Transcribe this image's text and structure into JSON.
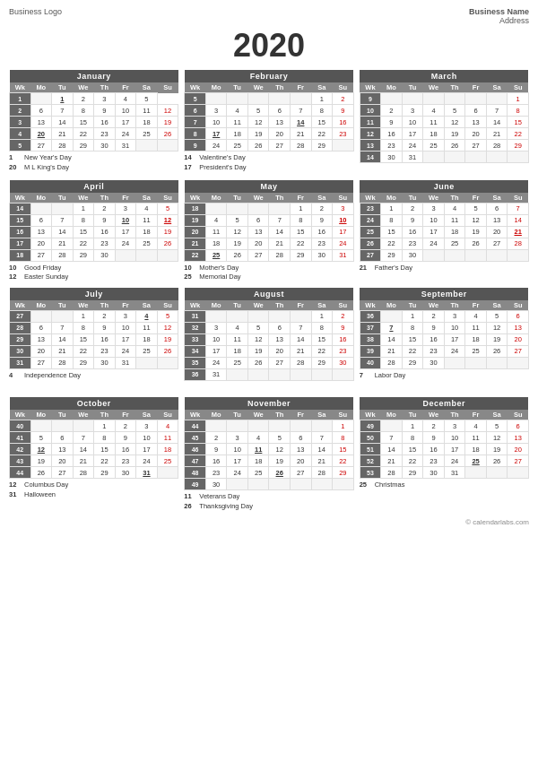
{
  "business_logo": "Business Logo",
  "business_name": "Business Name",
  "business_address": "Address",
  "year": "2020",
  "footer": "© calendarlabs.com",
  "months": [
    {
      "name": "January",
      "weeks": [
        [
          "1",
          "",
          "1",
          "2",
          "3",
          "4",
          "5"
        ],
        [
          "2",
          "6",
          "7",
          "8",
          "9",
          "10",
          "11",
          "12"
        ],
        [
          "3",
          "13",
          "14",
          "15",
          "16",
          "17",
          "18",
          "19"
        ],
        [
          "4",
          "20",
          "21",
          "22",
          "23",
          "24",
          "25",
          "26"
        ],
        [
          "5",
          "27",
          "28",
          "29",
          "30",
          "31",
          "",
          ""
        ]
      ],
      "holidays": [
        {
          "num": "1",
          "text": "New Year's Day"
        },
        {
          "num": "20",
          "text": "M L King's Day"
        }
      ],
      "bold_days": [
        "1",
        "20"
      ]
    },
    {
      "name": "February",
      "weeks": [
        [
          "5",
          "",
          "",
          "",
          "",
          "",
          "1",
          "2"
        ],
        [
          "6",
          "3",
          "4",
          "5",
          "6",
          "7",
          "8",
          "9"
        ],
        [
          "7",
          "10",
          "11",
          "12",
          "13",
          "14",
          "15",
          "16"
        ],
        [
          "8",
          "17",
          "18",
          "19",
          "20",
          "21",
          "22",
          "23"
        ],
        [
          "9",
          "24",
          "25",
          "26",
          "27",
          "28",
          "29",
          ""
        ]
      ],
      "holidays": [
        {
          "num": "14",
          "text": "Valentine's Day"
        },
        {
          "num": "17",
          "text": "President's Day"
        }
      ],
      "bold_days": [
        "14",
        "17"
      ]
    },
    {
      "name": "March",
      "weeks": [
        [
          "9",
          "",
          "",
          "",
          "",
          "",
          "",
          "1"
        ],
        [
          "10",
          "2",
          "3",
          "4",
          "5",
          "6",
          "7",
          "8"
        ],
        [
          "11",
          "9",
          "10",
          "11",
          "12",
          "13",
          "14",
          "15"
        ],
        [
          "12",
          "16",
          "17",
          "18",
          "19",
          "20",
          "21",
          "22"
        ],
        [
          "13",
          "23",
          "24",
          "25",
          "26",
          "27",
          "28",
          "29"
        ],
        [
          "14",
          "30",
          "31",
          "",
          "",
          "",
          "",
          ""
        ]
      ],
      "holidays": [],
      "bold_days": []
    },
    {
      "name": "April",
      "weeks": [
        [
          "14",
          "",
          "",
          "1",
          "2",
          "3",
          "4",
          "5"
        ],
        [
          "15",
          "6",
          "7",
          "8",
          "9",
          "10",
          "11",
          "12"
        ],
        [
          "16",
          "13",
          "14",
          "15",
          "16",
          "17",
          "18",
          "19"
        ],
        [
          "17",
          "20",
          "21",
          "22",
          "23",
          "24",
          "25",
          "26"
        ],
        [
          "18",
          "27",
          "28",
          "29",
          "30",
          "",
          "",
          ""
        ]
      ],
      "holidays": [
        {
          "num": "10",
          "text": "Good Friday"
        },
        {
          "num": "12",
          "text": "Easter Sunday"
        }
      ],
      "bold_days": [
        "10",
        "12"
      ]
    },
    {
      "name": "May",
      "weeks": [
        [
          "18",
          "",
          "",
          "",
          "",
          "1",
          "2",
          "3"
        ],
        [
          "19",
          "4",
          "5",
          "6",
          "7",
          "8",
          "9",
          "10"
        ],
        [
          "20",
          "11",
          "12",
          "13",
          "14",
          "15",
          "16",
          "17"
        ],
        [
          "21",
          "18",
          "19",
          "20",
          "21",
          "22",
          "23",
          "24"
        ],
        [
          "22",
          "25",
          "26",
          "27",
          "28",
          "29",
          "30",
          "31"
        ]
      ],
      "holidays": [
        {
          "num": "10",
          "text": "Mother's Day"
        },
        {
          "num": "25",
          "text": "Memorial Day"
        }
      ],
      "bold_days": [
        "10",
        "25"
      ]
    },
    {
      "name": "June",
      "weeks": [
        [
          "23",
          "1",
          "2",
          "3",
          "4",
          "5",
          "6",
          "7"
        ],
        [
          "24",
          "8",
          "9",
          "10",
          "11",
          "12",
          "13",
          "14"
        ],
        [
          "25",
          "15",
          "16",
          "17",
          "18",
          "19",
          "20",
          "21"
        ],
        [
          "26",
          "22",
          "23",
          "24",
          "25",
          "26",
          "27",
          "28"
        ],
        [
          "27",
          "29",
          "30",
          "",
          "",
          "",
          "",
          ""
        ]
      ],
      "holidays": [
        {
          "num": "21",
          "text": "Father's Day"
        }
      ],
      "bold_days": [
        "21"
      ]
    },
    {
      "name": "July",
      "weeks": [
        [
          "27",
          "",
          "",
          "1",
          "2",
          "3",
          "4",
          "5"
        ],
        [
          "28",
          "6",
          "7",
          "8",
          "9",
          "10",
          "11",
          "12"
        ],
        [
          "29",
          "13",
          "14",
          "15",
          "16",
          "17",
          "18",
          "19"
        ],
        [
          "30",
          "20",
          "21",
          "22",
          "23",
          "24",
          "25",
          "26"
        ],
        [
          "31",
          "27",
          "28",
          "29",
          "30",
          "31",
          "",
          ""
        ]
      ],
      "holidays": [
        {
          "num": "4",
          "text": "Independence Day"
        }
      ],
      "bold_days": [
        "4"
      ]
    },
    {
      "name": "August",
      "weeks": [
        [
          "31",
          "",
          "",
          "",
          "",
          "",
          "1",
          "2"
        ],
        [
          "32",
          "3",
          "4",
          "5",
          "6",
          "7",
          "8",
          "9"
        ],
        [
          "33",
          "10",
          "11",
          "12",
          "13",
          "14",
          "15",
          "16"
        ],
        [
          "34",
          "17",
          "18",
          "19",
          "20",
          "21",
          "22",
          "23"
        ],
        [
          "35",
          "24",
          "25",
          "26",
          "27",
          "28",
          "29",
          "30"
        ],
        [
          "36",
          "31",
          "",
          "",
          "",
          "",
          "",
          ""
        ]
      ],
      "holidays": [],
      "bold_days": []
    },
    {
      "name": "September",
      "weeks": [
        [
          "36",
          "",
          "1",
          "2",
          "3",
          "4",
          "5",
          "6"
        ],
        [
          "37",
          "7",
          "8",
          "9",
          "10",
          "11",
          "12",
          "13"
        ],
        [
          "38",
          "14",
          "15",
          "16",
          "17",
          "18",
          "19",
          "20"
        ],
        [
          "39",
          "21",
          "22",
          "23",
          "24",
          "25",
          "26",
          "27"
        ],
        [
          "40",
          "28",
          "29",
          "30",
          "",
          "",
          "",
          ""
        ]
      ],
      "holidays": [
        {
          "num": "7",
          "text": "Labor Day"
        }
      ],
      "bold_days": [
        "7"
      ]
    },
    {
      "name": "October",
      "weeks": [
        [
          "40",
          "",
          "",
          "",
          "1",
          "2",
          "3",
          "4"
        ],
        [
          "41",
          "5",
          "6",
          "7",
          "8",
          "9",
          "10",
          "11"
        ],
        [
          "42",
          "12",
          "13",
          "14",
          "15",
          "16",
          "17",
          "18"
        ],
        [
          "43",
          "19",
          "20",
          "21",
          "22",
          "23",
          "24",
          "25"
        ],
        [
          "44",
          "26",
          "27",
          "28",
          "29",
          "30",
          "31",
          ""
        ]
      ],
      "holidays": [
        {
          "num": "12",
          "text": "Columbus Day"
        },
        {
          "num": "31",
          "text": "Halloween"
        }
      ],
      "bold_days": [
        "12",
        "31"
      ]
    },
    {
      "name": "November",
      "weeks": [
        [
          "44",
          "",
          "",
          "",
          "",
          "",
          "",
          "1"
        ],
        [
          "45",
          "2",
          "3",
          "4",
          "5",
          "6",
          "7",
          "8"
        ],
        [
          "46",
          "9",
          "10",
          "11",
          "12",
          "13",
          "14",
          "15"
        ],
        [
          "47",
          "16",
          "17",
          "18",
          "19",
          "20",
          "21",
          "22"
        ],
        [
          "48",
          "23",
          "24",
          "25",
          "26",
          "27",
          "28",
          "29"
        ],
        [
          "49",
          "30",
          "",
          "",
          "",
          "",
          "",
          ""
        ]
      ],
      "holidays": [
        {
          "num": "11",
          "text": "Veterans Day"
        },
        {
          "num": "26",
          "text": "Thanksgiving Day"
        }
      ],
      "bold_days": [
        "11",
        "26"
      ]
    },
    {
      "name": "December",
      "weeks": [
        [
          "49",
          "",
          "1",
          "2",
          "3",
          "4",
          "5",
          "6"
        ],
        [
          "50",
          "7",
          "8",
          "9",
          "10",
          "11",
          "12",
          "13"
        ],
        [
          "51",
          "14",
          "15",
          "16",
          "17",
          "18",
          "19",
          "20"
        ],
        [
          "52",
          "21",
          "22",
          "23",
          "24",
          "25",
          "26",
          "27"
        ],
        [
          "53",
          "28",
          "29",
          "30",
          "31",
          "",
          "",
          ""
        ]
      ],
      "holidays": [
        {
          "num": "25",
          "text": "Christmas"
        }
      ],
      "bold_days": [
        "25"
      ]
    }
  ],
  "day_headers": [
    "Wk",
    "Mo",
    "Tu",
    "We",
    "Th",
    "Fr",
    "Sa",
    "Su"
  ]
}
